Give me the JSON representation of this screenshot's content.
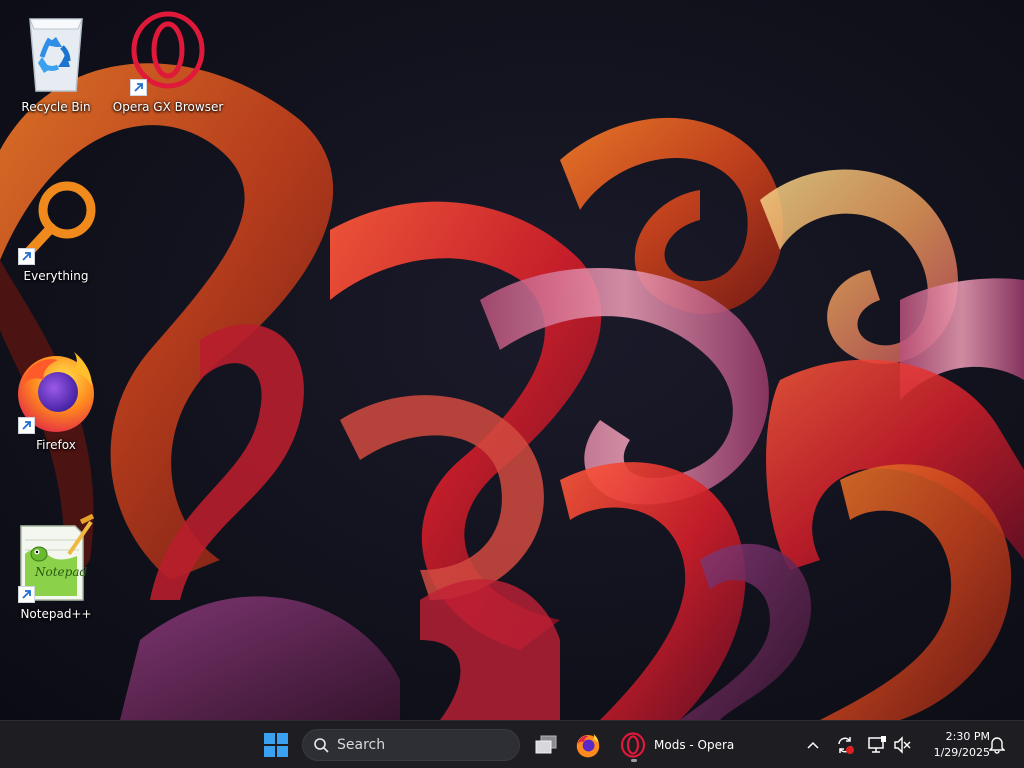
{
  "desktop": {
    "icons": [
      {
        "label": "Recycle Bin",
        "icon": "recycle-bin-icon"
      },
      {
        "label": "Opera GX Browser",
        "icon": "opera-gx-icon"
      },
      {
        "label": "Everything",
        "icon": "everything-search-icon"
      },
      {
        "label": "Firefox",
        "icon": "firefox-icon"
      },
      {
        "label": "Notepad++",
        "icon": "notepad-plus-plus-icon"
      }
    ]
  },
  "taskbar": {
    "search_placeholder": "Search",
    "opera_window_title": "Mods - Opera",
    "clock": {
      "time": "2:30 PM",
      "date": "1/29/2025"
    }
  },
  "colors": {
    "taskbar_bg": "#1d1d22",
    "accent_blue": "#3aa0f0",
    "opera_red": "#e0183a",
    "everything_orange": "#f08a1c"
  }
}
